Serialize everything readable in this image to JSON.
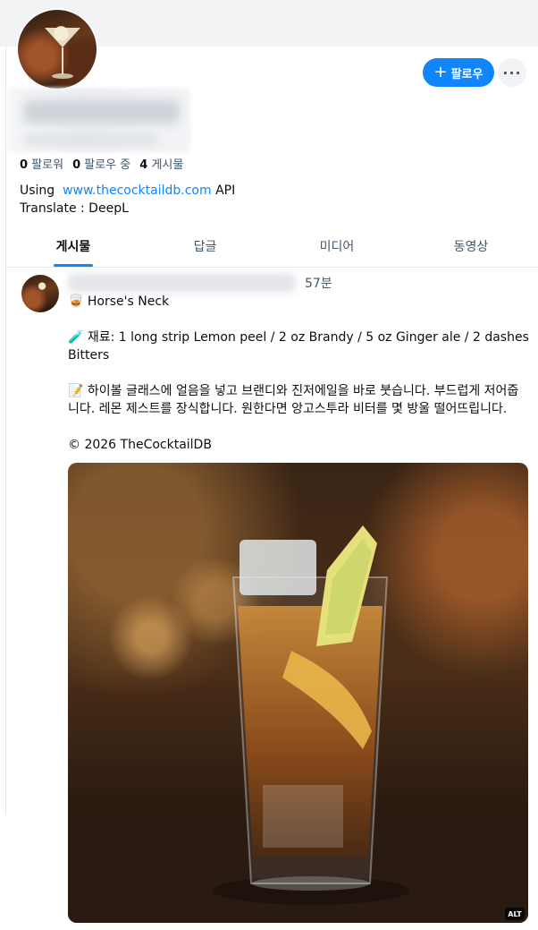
{
  "profile": {
    "follow_label": "팔로우",
    "more_icon": "ellipsis-icon",
    "stats": {
      "followers_count": "0",
      "followers_label": "팔로워",
      "following_count": "0",
      "following_label": "팔로우 중",
      "posts_count": "4",
      "posts_label": "게시물"
    },
    "bio": {
      "line1_prefix": "Using",
      "line1_link": "www.thecocktaildb.com",
      "line1_suffix": "API",
      "line2": "Translate : DeepL"
    }
  },
  "tabs": [
    {
      "label": "게시물",
      "active": true
    },
    {
      "label": "답글",
      "active": false
    },
    {
      "label": "미디어",
      "active": false
    },
    {
      "label": "동영상",
      "active": false
    }
  ],
  "post": {
    "time": "57분",
    "title": "🥃 Horse's Neck",
    "ingredients": "🧪 재료: 1 long strip Lemon peel / 2 oz Brandy / 5 oz Ginger ale / 2 dashes Bitters",
    "instructions": "📝 하이볼 글래스에 얼음을 넣고 브랜디와 진저에일을 바로 붓습니다. 부드럽게 저어줍니다. 레몬 제스트를 장식합니다. 원한다면 앙고스투라 비터를 몇 방울 떨어뜨립니다.",
    "copyright": "© 2026 TheCocktailDB",
    "alt_badge": "ALT"
  },
  "colors": {
    "accent": "#1185fe",
    "muted_text": "#42576c",
    "banner": "#f1f3f5"
  }
}
